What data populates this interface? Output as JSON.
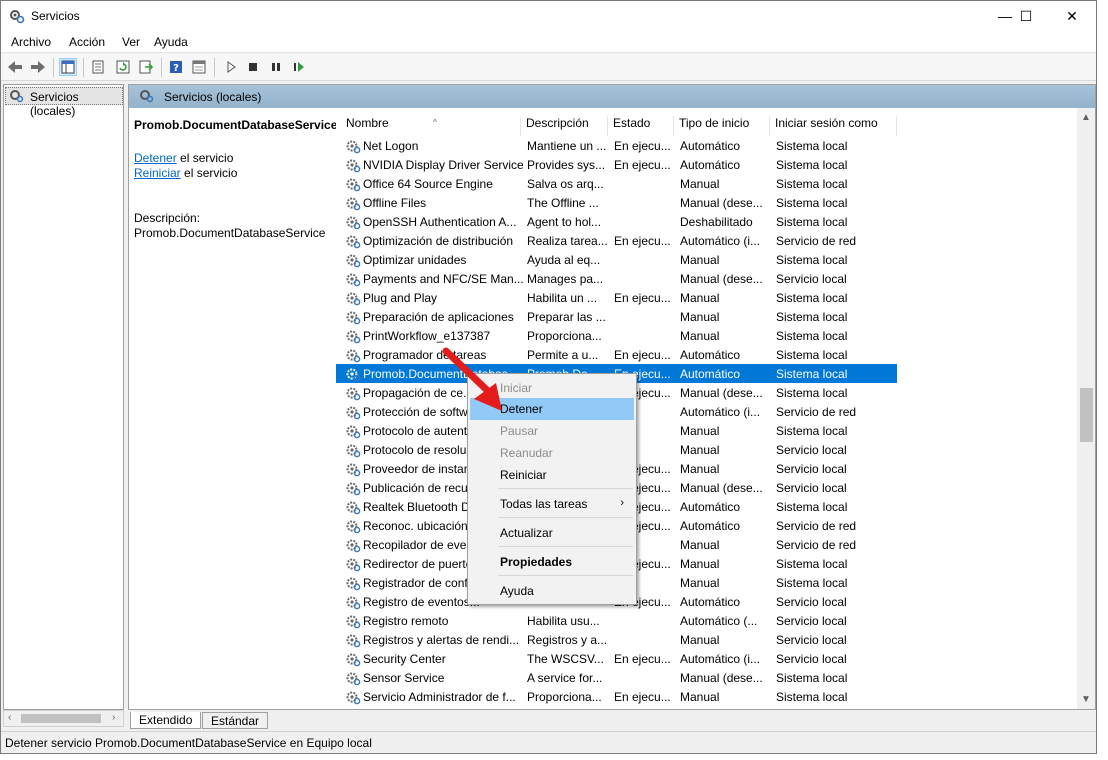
{
  "window": {
    "title": "Servicios"
  },
  "window_buttons": {
    "minimize": "—",
    "maximize": "☐",
    "close": "✕"
  },
  "menu": [
    "Archivo",
    "Acción",
    "Ver",
    "Ayuda"
  ],
  "tree": {
    "root": "Servicios (locales)"
  },
  "content_header": "Servicios (locales)",
  "extended": {
    "service_name": "Promob.DocumentDatabaseService",
    "stop_link": "Detener",
    "stop_suffix": " el servicio",
    "restart_link": "Reiniciar",
    "restart_suffix": " el servicio",
    "desc_label": "Descripción:",
    "desc_value": "Promob.DocumentDatabaseService"
  },
  "columns": [
    "Nombre",
    "Descripción",
    "Estado",
    "Tipo de inicio",
    "Iniciar sesión como"
  ],
  "rows": [
    [
      "Net Logon",
      "Mantiene un ...",
      "En ejecu...",
      "Automático",
      "Sistema local"
    ],
    [
      "NVIDIA Display Driver Service",
      "Provides sys...",
      "En ejecu...",
      "Automático",
      "Sistema local"
    ],
    [
      "Office 64 Source Engine",
      "Salva os arq...",
      "",
      "Manual",
      "Sistema local"
    ],
    [
      "Offline Files",
      "The Offline ...",
      "",
      "Manual (dese...",
      "Sistema local"
    ],
    [
      "OpenSSH Authentication A...",
      "Agent to hol...",
      "",
      "Deshabilitado",
      "Sistema local"
    ],
    [
      "Optimización de distribución",
      "Realiza tarea...",
      "En ejecu...",
      "Automático (i...",
      "Servicio de red"
    ],
    [
      "Optimizar unidades",
      "Ayuda al eq...",
      "",
      "Manual",
      "Sistema local"
    ],
    [
      "Payments and NFC/SE Man...",
      "Manages pa...",
      "",
      "Manual (dese...",
      "Servicio local"
    ],
    [
      "Plug and Play",
      "Habilita un ...",
      "En ejecu...",
      "Manual",
      "Sistema local"
    ],
    [
      "Preparación de aplicaciones",
      "Preparar las ...",
      "",
      "Manual",
      "Sistema local"
    ],
    [
      "PrintWorkflow_e137387",
      "Proporciona...",
      "",
      "Manual",
      "Sistema local"
    ],
    [
      "Programador de tareas",
      "Permite a u...",
      "En ejecu...",
      "Automático",
      "Sistema local"
    ],
    [
      "Promob.DocumentDatabas...",
      "Promob.Do...",
      "En ejecu...",
      "Automático",
      "Sistema local"
    ],
    [
      "Propagación de ce...",
      "",
      "En ejecu...",
      "Manual (dese...",
      "Sistema local"
    ],
    [
      "Protección de softw...",
      "",
      "",
      "Automático (i...",
      "Servicio de red"
    ],
    [
      "Protocolo de autent...",
      "",
      "",
      "Manual",
      "Sistema local"
    ],
    [
      "Protocolo de resolu...",
      "",
      "",
      "Manual",
      "Servicio local"
    ],
    [
      "Proveedor de instan...",
      "",
      "En ejecu...",
      "Manual",
      "Servicio local"
    ],
    [
      "Publicación de recu...",
      "",
      "En ejecu...",
      "Manual (dese...",
      "Servicio local"
    ],
    [
      "Realtek Bluetooth D...",
      "",
      "En ejecu...",
      "Automático",
      "Sistema local"
    ],
    [
      "Reconoc. ubicación...",
      "",
      "En ejecu...",
      "Automático",
      "Servicio de red"
    ],
    [
      "Recopilador de even...",
      "",
      "",
      "Manual",
      "Servicio de red"
    ],
    [
      "Redirector de puerto...",
      "",
      "En ejecu...",
      "Manual",
      "Sistema local"
    ],
    [
      "Registrador de conf...",
      "",
      "",
      "Manual",
      "Sistema local"
    ],
    [
      "Registro de eventos...",
      "",
      "En ejecu...",
      "Automático",
      "Servicio local"
    ],
    [
      "Registro remoto",
      "Habilita usu...",
      "",
      "Automático (...",
      "Servicio local"
    ],
    [
      "Registros y alertas de rendi...",
      "Registros y a...",
      "",
      "Manual",
      "Servicio local"
    ],
    [
      "Security Center",
      "The WSCSV...",
      "En ejecu...",
      "Automático (i...",
      "Servicio local"
    ],
    [
      "Sensor Service",
      "A service for...",
      "",
      "Manual (dese...",
      "Sistema local"
    ],
    [
      "Servicio Administrador de f...",
      "Proporciona...",
      "En ejecu...",
      "Manual",
      "Sistema local"
    ]
  ],
  "selected_row": 12,
  "context_menu": {
    "items": [
      {
        "label": "Iniciar",
        "state": "disabled"
      },
      {
        "label": "Detener",
        "state": "hover"
      },
      {
        "label": "Pausar",
        "state": "disabled"
      },
      {
        "label": "Reanudar",
        "state": "disabled"
      },
      {
        "label": "Reiniciar",
        "state": "normal"
      },
      {
        "label": "Todas las tareas",
        "state": "submenu"
      },
      {
        "label": "Actualizar",
        "state": "normal"
      },
      {
        "label": "Propiedades",
        "state": "bold"
      },
      {
        "label": "Ayuda",
        "state": "normal"
      }
    ]
  },
  "tabs": [
    "Extendido",
    "Estándar"
  ],
  "status": "Detener servicio Promob.DocumentDatabaseService en Equipo local",
  "colors": {
    "selection": "#0078d7",
    "menu_hover": "#91c9f7",
    "header_band": "#a6c2d8",
    "annotation_arrow": "#e51c1c"
  },
  "icons": [
    "services-gear-icon",
    "back-arrow-icon",
    "forward-arrow-icon",
    "show-hide-tree-icon",
    "properties-icon",
    "refresh-icon",
    "export-list-icon",
    "help-icon",
    "console-view-icon",
    "play-icon",
    "stop-icon",
    "pause-icon",
    "resume-icon"
  ]
}
